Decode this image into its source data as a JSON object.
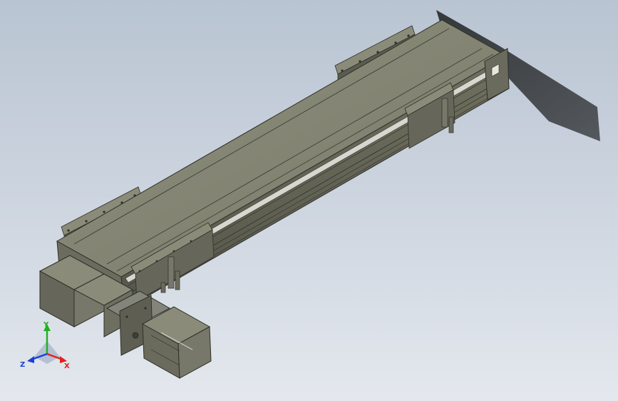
{
  "viewport": {
    "background_top": "#b9c4d2",
    "background_bottom": "#e4e8ee",
    "model_color": "#7c7d6c",
    "model_dark": "#4a4b40",
    "model_light": "#9c9d8a",
    "shadow_color": "#2b2e30"
  },
  "triad": {
    "x_label": "X",
    "y_label": "Y",
    "z_label": "Z",
    "x_color": "#e0231c",
    "y_color": "#1fb11f",
    "z_color": "#1c3fd6"
  }
}
